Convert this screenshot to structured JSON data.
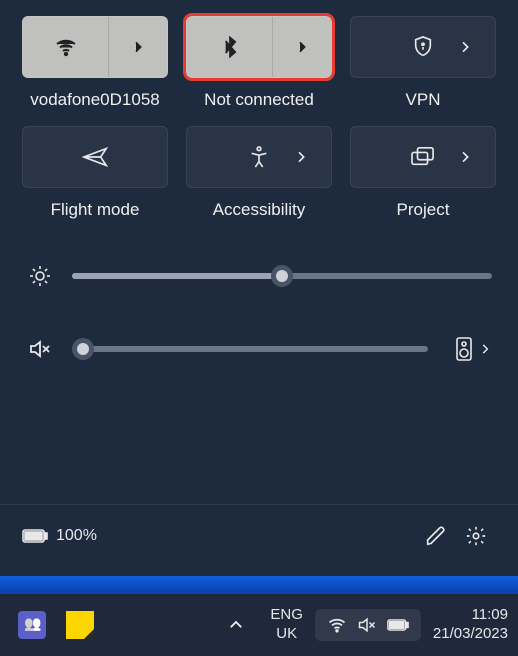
{
  "tiles": [
    {
      "id": "wifi",
      "label": "vodafone0D1058",
      "active": true,
      "split": true,
      "highlighted": false,
      "icon": "wifi-icon"
    },
    {
      "id": "bluetooth",
      "label": "Not connected",
      "active": true,
      "split": true,
      "highlighted": true,
      "icon": "bluetooth-icon"
    },
    {
      "id": "vpn",
      "label": "VPN",
      "active": false,
      "split": false,
      "highlighted": false,
      "icon": "shield-icon"
    },
    {
      "id": "flight",
      "label": "Flight mode",
      "active": false,
      "split": false,
      "highlighted": false,
      "icon": "airplane-icon",
      "no_arrow": true
    },
    {
      "id": "accessibility",
      "label": "Accessibility",
      "active": false,
      "split": false,
      "highlighted": false,
      "icon": "accessibility-icon"
    },
    {
      "id": "project",
      "label": "Project",
      "active": false,
      "split": false,
      "highlighted": false,
      "icon": "project-icon"
    }
  ],
  "sliders": {
    "brightness": {
      "value": 50
    },
    "volume": {
      "value": 3
    }
  },
  "battery": {
    "percent_label": "100%"
  },
  "taskbar": {
    "lang_top": "ENG",
    "lang_bottom": "UK",
    "time": "11:09",
    "date": "21/03/2023"
  }
}
